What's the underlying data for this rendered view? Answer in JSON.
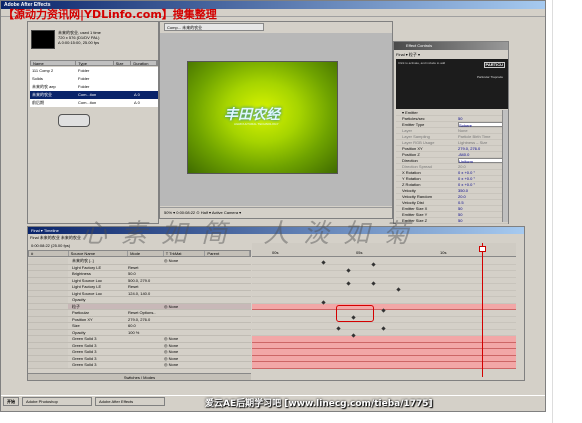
{
  "window": {
    "title": "Adobe After Effects"
  },
  "watermark_top": "【源动力资讯网|YDLinfo.com】搜集整理",
  "project": {
    "comp_name": "未来的农业, used 1 time",
    "comp_info": "720 x 576 (D1/DV PAL)",
    "comp_duration": "Δ 0:00:15:00, 25.00 fps",
    "columns": [
      "Name",
      "Type",
      "Size",
      "Duration"
    ],
    "rows": [
      {
        "name": "111 Comp 2",
        "type": "Folder",
        "size": "",
        "dur": ""
      },
      {
        "name": "Solids",
        "type": "Folder",
        "size": "",
        "dur": ""
      },
      {
        "name": "未来的农 aep",
        "type": "Folder",
        "size": "",
        "dur": ""
      },
      {
        "name": "未来的农业",
        "type": "Com...tion",
        "size": "",
        "dur": "Δ 0"
      },
      {
        "name": "前后期",
        "type": "Com...tion",
        "size": "",
        "dur": "Δ 0"
      }
    ]
  },
  "comp": {
    "tab": "Comp... 未来的农业",
    "title": "丰田农经",
    "subtitle": "AGRICULTURAL TECHNOLOGY",
    "footer": "50% ▾ 0:00:08:22 ⊙ Half ▾ Active Camera ▾"
  },
  "fx": {
    "title": "Effect Controls",
    "tab": "Final ▾ 粒子 ▾",
    "banner_left": "Click to activate, and include to add",
    "banner_logo": "PARTICU",
    "banner_right": "Particular Trapcode",
    "rows": [
      {
        "n": "▾ Emitter",
        "v": ""
      },
      {
        "n": "Particles/sec",
        "v": "50"
      },
      {
        "n": "Emitter Type",
        "v": "Sphere"
      },
      {
        "n": "Layer",
        "v": "None"
      },
      {
        "n": "Layer Sampling",
        "v": "Particle Birth Time"
      },
      {
        "n": "Layer RGB Usage",
        "v": "Lightness – Size"
      },
      {
        "n": "Position XY",
        "v": "279.0, 276.0"
      },
      {
        "n": "Position Z",
        "v": "-840.0"
      },
      {
        "n": "Direction",
        "v": "Uniform"
      },
      {
        "n": "Direction Spread",
        "v": "20.0"
      },
      {
        "n": "X Rotation",
        "v": "0 x +0.0 °"
      },
      {
        "n": "Y Rotation",
        "v": "0 x +0.0 °"
      },
      {
        "n": "Z Rotation",
        "v": "0 x +0.0 °"
      },
      {
        "n": "Velocity",
        "v": "350.0"
      },
      {
        "n": "Velocity Random",
        "v": "20.0"
      },
      {
        "n": "Velocity Dist",
        "v": "0.5"
      },
      {
        "n": "Emitter Size X",
        "v": "50"
      },
      {
        "n": "Emitter Size Y",
        "v": "50"
      },
      {
        "n": "Emitter Size Z",
        "v": "50"
      }
    ]
  },
  "timeline": {
    "title": "Final ▾ Timeline",
    "tabs": "Final  未来的农业  未来的农业",
    "time": "0:00:08:22 (25.00 fps)",
    "columns": [
      "# ",
      "Source Name",
      "Mode",
      "T TrkMat",
      "Parent"
    ],
    "rows": [
      {
        "name": "未来的农 [..]",
        "pr": "",
        "mode": "◎ None",
        "par": "",
        "sel": false,
        "layer": true
      },
      {
        "name": "Light Factory LE",
        "pr": "Reset",
        "mode": "",
        "par": "",
        "sel": false,
        "layer": false
      },
      {
        "name": "Brightness",
        "pr": "50.0",
        "mode": "",
        "par": "",
        "sel": false,
        "layer": false
      },
      {
        "name": "Light Source Loc",
        "pr": "500.0, 279.0",
        "mode": "",
        "par": "",
        "sel": false,
        "layer": false
      },
      {
        "name": "Light Factory LE",
        "pr": "Reset",
        "mode": "",
        "par": "",
        "sel": false,
        "layer": false
      },
      {
        "name": "Light Source Loc",
        "pr": "124.0, 140.0",
        "mode": "",
        "par": "",
        "sel": false,
        "layer": false
      },
      {
        "name": "Opacity",
        "pr": "",
        "mode": "",
        "par": "",
        "sel": false,
        "layer": false
      },
      {
        "name": "粒子",
        "pr": "",
        "mode": "◎ None",
        "par": "",
        "sel": true,
        "layer": true
      },
      {
        "name": "Particular",
        "pr": "Reset Options..",
        "mode": "",
        "par": "",
        "sel": false,
        "layer": false
      },
      {
        "name": "Position XY",
        "pr": "279.0, 276.0",
        "mode": "",
        "par": "",
        "sel": false,
        "layer": false
      },
      {
        "name": "Size",
        "pr": "60.0",
        "mode": "",
        "par": "",
        "sel": false,
        "layer": false
      },
      {
        "name": "Opacity",
        "pr": "100 %",
        "mode": "",
        "par": "",
        "sel": false,
        "layer": false
      },
      {
        "name": "Green Solid 3",
        "pr": "",
        "mode": "◎ None",
        "par": "",
        "sel": false,
        "layer": true
      },
      {
        "name": "Green Solid 3",
        "pr": "",
        "mode": "◎ None",
        "par": "",
        "sel": false,
        "layer": true
      },
      {
        "name": "Green Solid 3",
        "pr": "",
        "mode": "◎ None",
        "par": "",
        "sel": false,
        "layer": true
      },
      {
        "name": "Green Solid 3",
        "pr": "",
        "mode": "◎ None",
        "par": "",
        "sel": false,
        "layer": true
      },
      {
        "name": "Green Solid 3",
        "pr": "",
        "mode": "◎ None",
        "par": "",
        "sel": false,
        "layer": true
      }
    ],
    "ruler": [
      "00s",
      "05s",
      "10s",
      "15s"
    ],
    "footer": "Switches / Modes"
  },
  "taskbar": {
    "items": [
      "开始",
      "Adobe Photoshop",
      "Adobe After Effects"
    ]
  },
  "calligraphy": "心素如简 人淡如菊",
  "watermark_bottom": "爱云AE后期学习吧 [www.linecg.com/tieba/1775]",
  "colors": {
    "title_blue": "#0a246a",
    "track_pink": "#f2a7a7",
    "cti_red": "#d40000",
    "watermark_red": "#d40000"
  }
}
